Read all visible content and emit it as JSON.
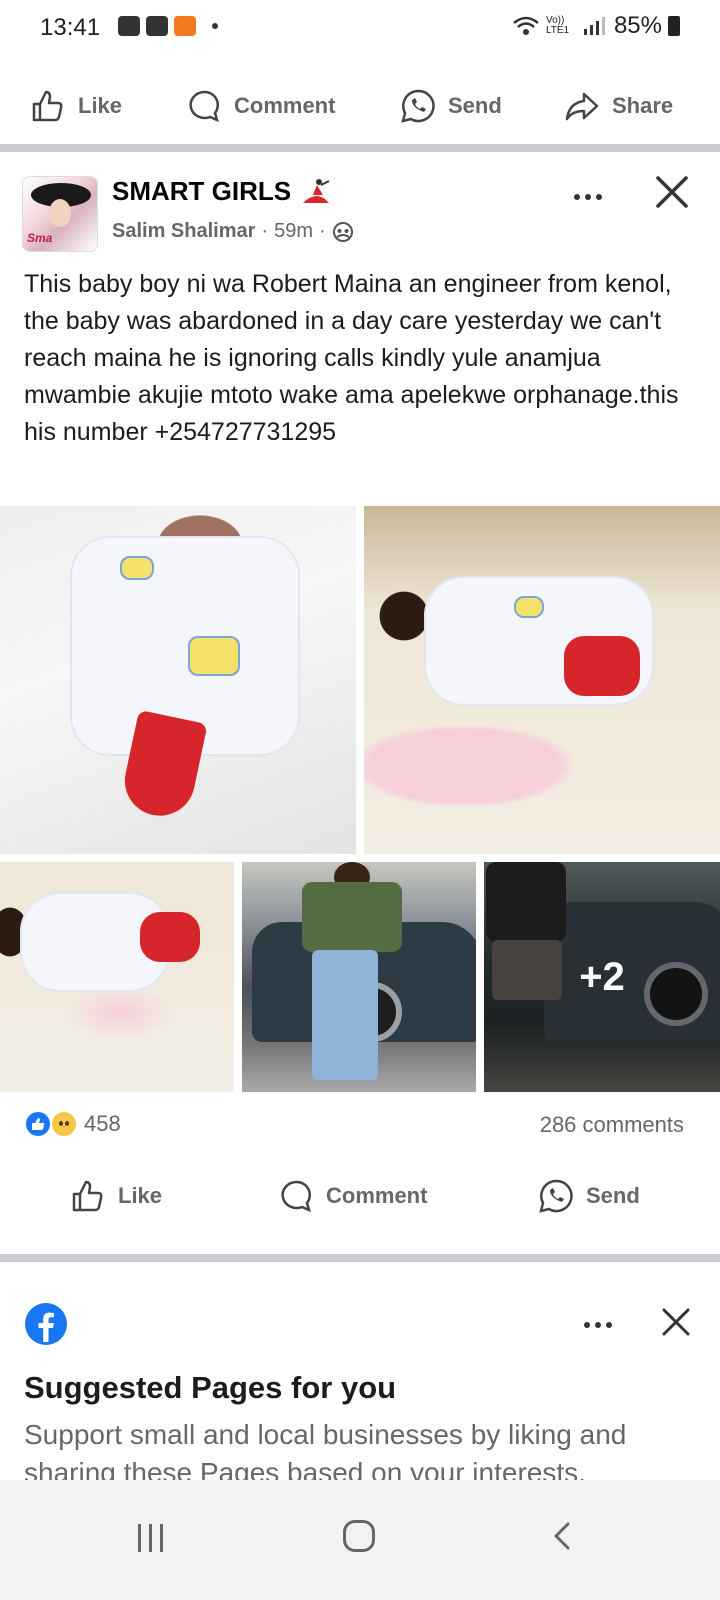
{
  "status_bar": {
    "time": "13:41",
    "battery": "85%",
    "network": "Vo)) LTE1"
  },
  "top_actions": {
    "like": "Like",
    "comment": "Comment",
    "send": "Send",
    "share": "Share"
  },
  "post": {
    "group_name": "SMART GIRLS",
    "avatar_tag": "Sma",
    "author": "Salim Shalimar",
    "time_ago": "59m",
    "meta_sep": "·",
    "text": "This baby boy ni wa Robert Maina an engineer from kenol, the baby was abardoned in a day care yesterday we can't reach maina he is ignoring calls kindly yule anamjua mwambie akujie mtoto wake ama apelekwe orphanage.this his number +254727731295",
    "more_photos_label": "+2",
    "reaction_count": "458",
    "comments_count": "286 comments",
    "actions": {
      "like": "Like",
      "comment": "Comment",
      "send": "Send"
    }
  },
  "suggested": {
    "title": "Suggested Pages for you",
    "description": "Support small and local businesses by liking and sharing these Pages based on your interests."
  },
  "colors": {
    "facebook_blue": "#1877f2",
    "secondary_text": "#65676b",
    "separator": "#c9ccd1"
  },
  "icons": [
    "like-icon",
    "comment-icon",
    "whatsapp-icon",
    "share-icon",
    "more-icon",
    "close-icon",
    "globe-icon",
    "facebook-logo-icon"
  ]
}
